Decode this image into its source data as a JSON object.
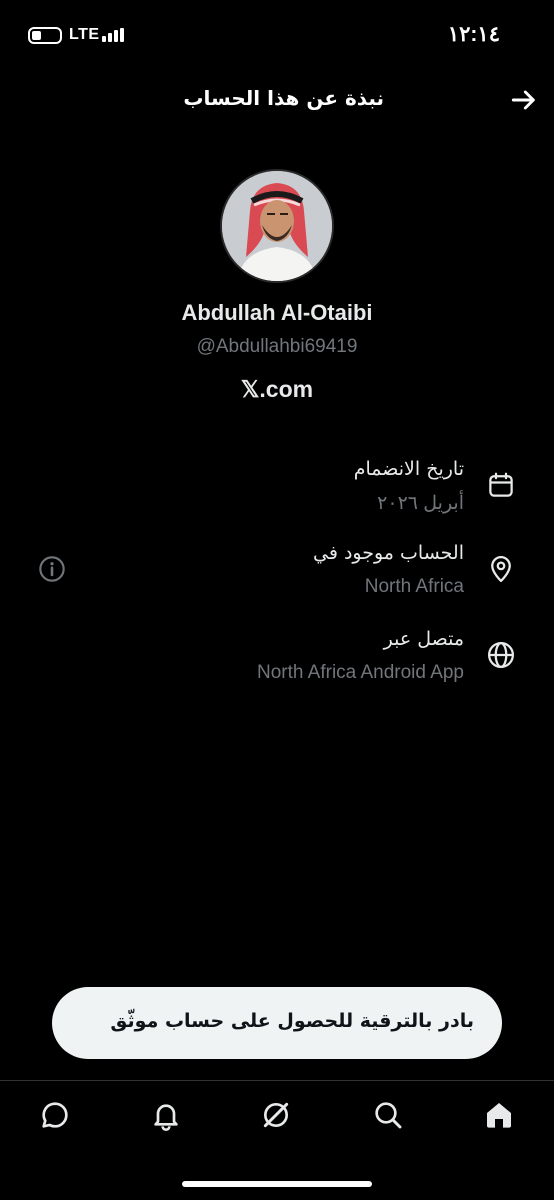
{
  "status_bar": {
    "time": "١٢:١٤",
    "network": "LTE"
  },
  "header": {
    "title": "نبذة عن هذا الحساب"
  },
  "profile": {
    "name": "Abdullah Al-Otaibi",
    "handle": "@Abdullahbi69419",
    "site": "𝕏.com"
  },
  "details": [
    {
      "label": "تاريخ الانضمام",
      "value": "أبريل ٢٠٢٦",
      "icon": "calendar-icon"
    },
    {
      "label": "الحساب موجود في",
      "value": "North Africa",
      "icon": "location-pin-icon"
    },
    {
      "label": "متصل عبر",
      "value": "North Africa Android App",
      "icon": "globe-icon"
    }
  ],
  "upgrade": {
    "label": "بادر بالترقية للحصول على حساب موثّق"
  },
  "nav": [
    "home-icon",
    "search-icon",
    "grok-icon",
    "notifications-icon",
    "messages-icon"
  ]
}
